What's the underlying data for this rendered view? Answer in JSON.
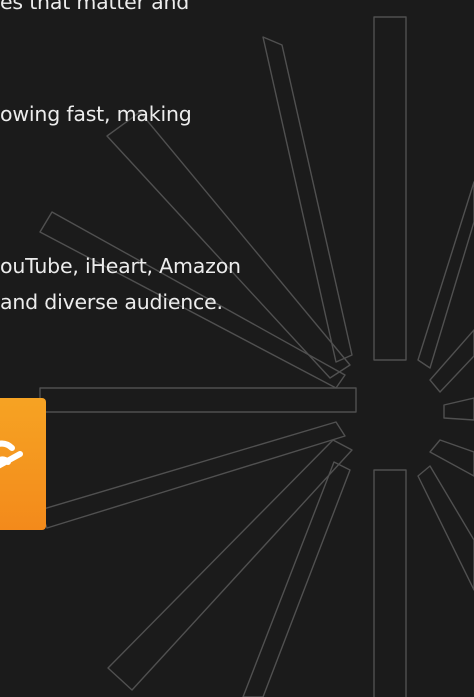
{
  "body": {
    "line_1": "es that matter and",
    "line_2": "owing fast, making",
    "line_3": "ouTube, iHeart, Amazon",
    "line_4": "and diverse audience."
  },
  "logo": {
    "name": "audible-icon",
    "color": "#f5951f"
  },
  "colors": {
    "background": "#1b1b1b",
    "text": "#ececec",
    "line_art": "#505050"
  }
}
